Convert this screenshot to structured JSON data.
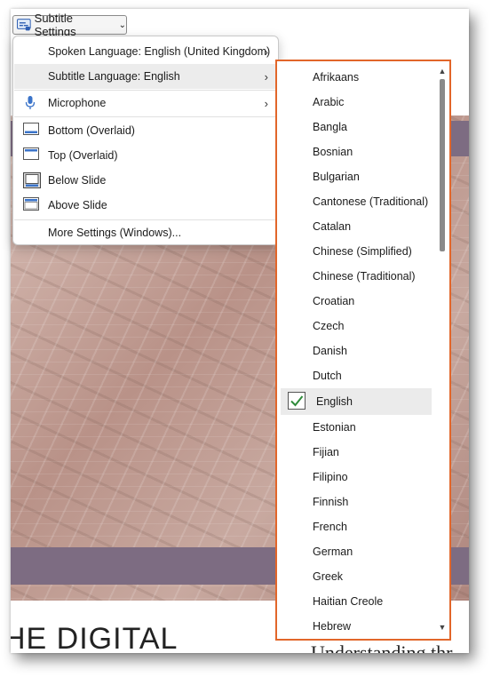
{
  "toolbar": {
    "subtitle_settings_label": "Subtitle Settings",
    "subtitle_icon": "closed-captions-icon",
    "dropdown_icon": "chevron-down-icon"
  },
  "menu": {
    "items": [
      {
        "label": "Spoken Language: English (United Kingdom)",
        "has_submenu": true
      },
      {
        "label": "Subtitle Language: English",
        "has_submenu": true,
        "highlighted": true
      },
      {
        "label": "Microphone",
        "icon": "microphone-icon",
        "has_submenu": true
      },
      {
        "label": "Bottom (Overlaid)",
        "icon": "bottom-overlaid-icon"
      },
      {
        "label": "Top (Overlaid)",
        "icon": "top-overlaid-icon"
      },
      {
        "label": "Below Slide",
        "icon": "below-slide-icon",
        "selected": true
      },
      {
        "label": "Above Slide",
        "icon": "above-slide-icon"
      },
      {
        "label": "More Settings (Windows)..."
      }
    ],
    "submenu_arrow": "›"
  },
  "languages": {
    "items": [
      "Afrikaans",
      "Arabic",
      "Bangla",
      "Bosnian",
      "Bulgarian",
      "Cantonese (Traditional)",
      "Catalan",
      "Chinese (Simplified)",
      "Chinese (Traditional)",
      "Croatian",
      "Czech",
      "Danish",
      "Dutch",
      "English",
      "Estonian",
      "Fijian",
      "Filipino",
      "Finnish",
      "French",
      "German",
      "Greek",
      "Haitian Creole",
      "Hebrew"
    ],
    "selected": "English",
    "highlight_color": "#e2662a"
  },
  "slide": {
    "title_fragment": "HE DIGITAL",
    "subtitle_fragment": "Understanding thr"
  },
  "colors": {
    "accent_border": "#e2662a",
    "slide_band": "#7d6c82",
    "check": "#2e8b3a"
  }
}
